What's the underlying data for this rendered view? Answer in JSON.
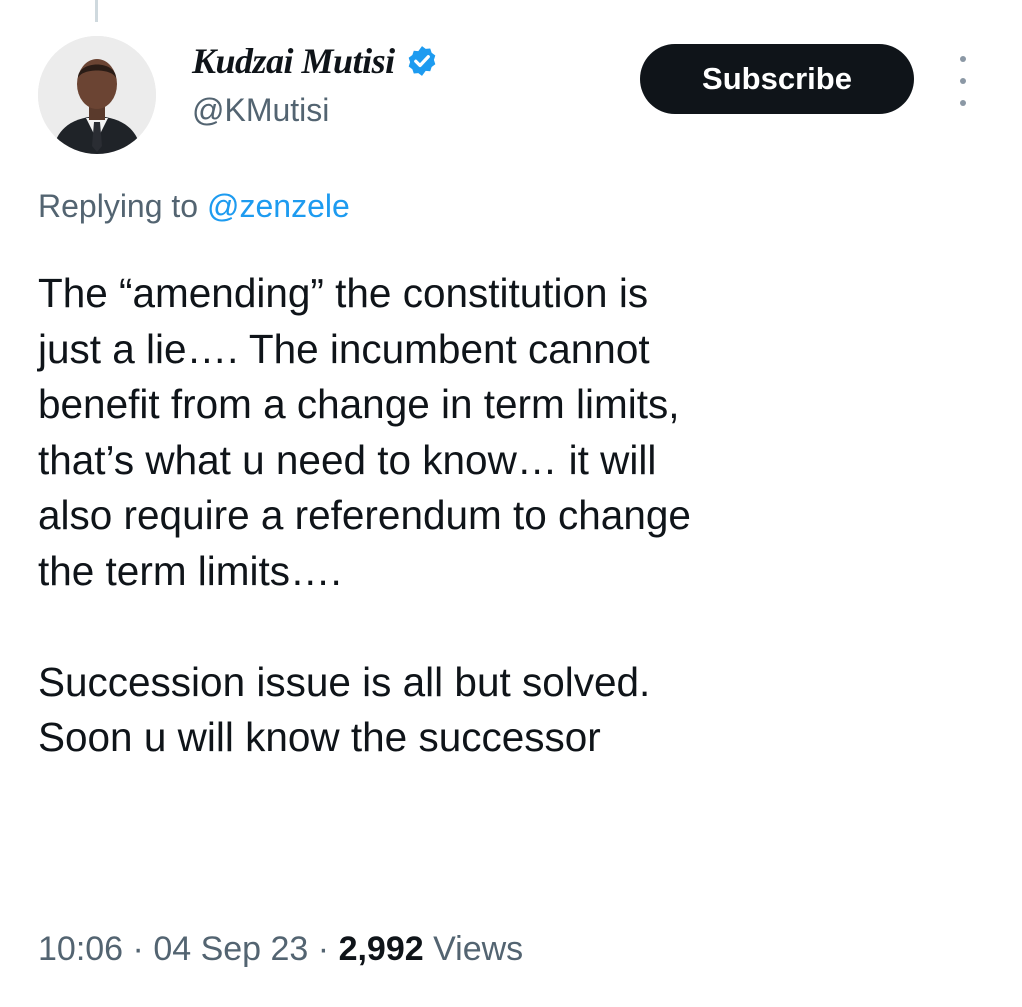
{
  "author": {
    "display_name": "Kudzai Mutisi",
    "handle": "@KMutisi",
    "verified_icon": "verified-badge-icon",
    "avatar_icon": "profile-photo"
  },
  "actions": {
    "subscribe_label": "Subscribe",
    "more_icon": "more-options-icon"
  },
  "reply": {
    "prefix": "Replying to ",
    "mention": "@zenzele"
  },
  "tweet": {
    "paragraph_1": "The “amending” the constitution is\njust a lie…. The incumbent cannot\nbenefit from a change in term limits,\nthat’s what u need to know… it will\nalso require a referendum to change\nthe term limits….",
    "paragraph_2": "Succession issue is all but solved.\nSoon u will know the successor"
  },
  "meta": {
    "time": "10:06",
    "separator": " · ",
    "date": "04 Sep 23",
    "views_count": "2,992",
    "views_label": " Views"
  },
  "colors": {
    "text_primary": "#0f1419",
    "text_secondary": "#536471",
    "link": "#1d9bf0",
    "button_bg": "#0f1419",
    "verified": "#1d9bf0"
  }
}
